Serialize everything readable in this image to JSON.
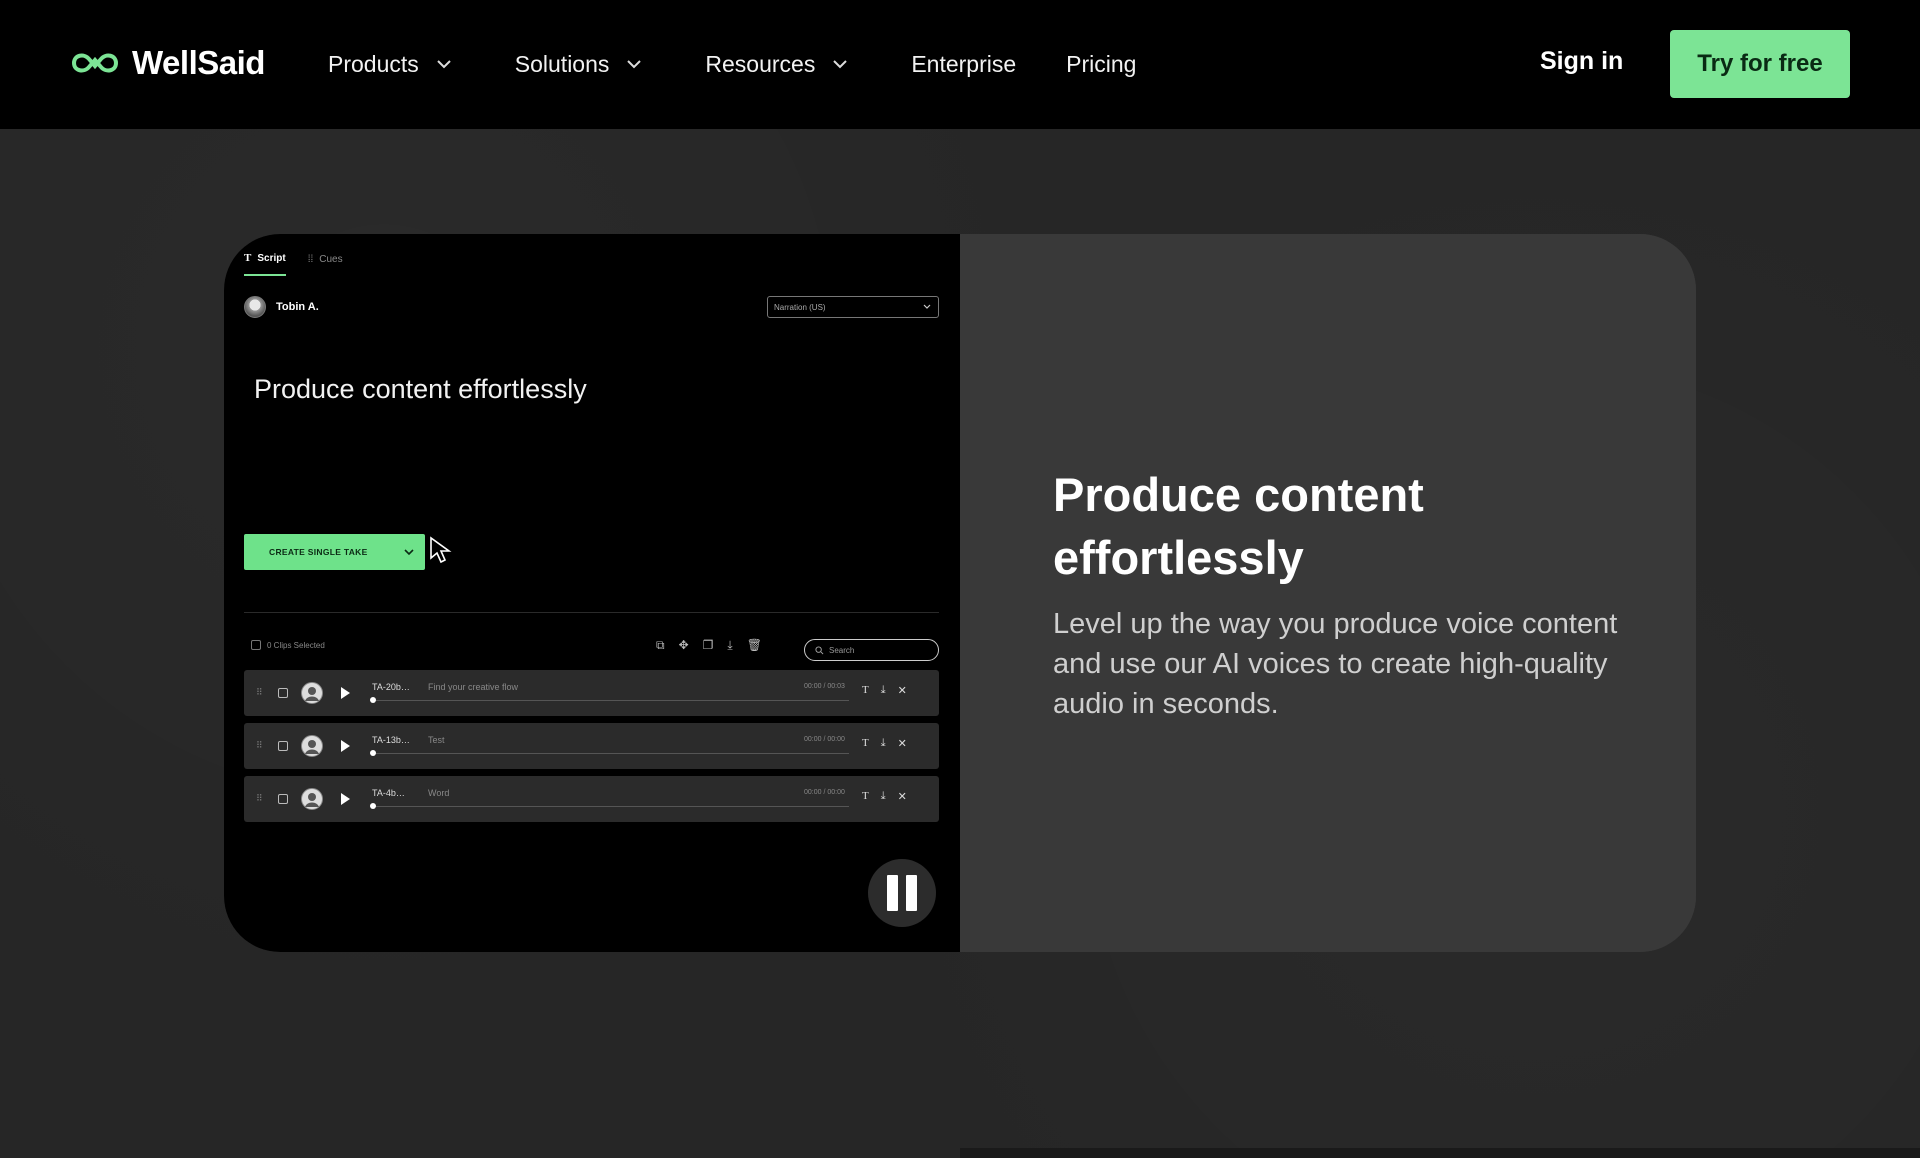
{
  "nav": {
    "brand": "WellSaid",
    "menu": [
      {
        "label": "Products",
        "has_dropdown": true
      },
      {
        "label": "Solutions",
        "has_dropdown": true
      },
      {
        "label": "Resources",
        "has_dropdown": true
      },
      {
        "label": "Enterprise",
        "has_dropdown": false
      },
      {
        "label": "Pricing",
        "has_dropdown": false
      }
    ],
    "signin": "Sign in",
    "cta": "Try for free"
  },
  "colors": {
    "accent": "#7ce495",
    "nav_bg": "#000000",
    "page_bg": "#262626",
    "card_bg": "#393939"
  },
  "feature": {
    "headline": "Produce content effortlessly",
    "description": "Level up the way you produce voice content and use our AI voices to create high-quality audio in seconds."
  },
  "app": {
    "tabs": [
      {
        "label": "Script",
        "active": true,
        "icon": "text-icon"
      },
      {
        "label": "Cues",
        "active": false,
        "icon": "cues-icon"
      }
    ],
    "user_name": "Tobin A.",
    "voice_style": "Narration (US)",
    "script_text": "Produce content effortlessly",
    "create_button": "CREATE SINGLE TAKE",
    "clips_selected": "0 Clips Selected",
    "search_placeholder": "Search",
    "clips": [
      {
        "id": "TA-20b…",
        "text": "Find your creative flow",
        "time": "00:00 / 00:03"
      },
      {
        "id": "TA-13b…",
        "text": "Test",
        "time": "00:00 / 00:00"
      },
      {
        "id": "TA-4b…",
        "text": "Word",
        "time": "00:00 / 00:00"
      }
    ]
  }
}
